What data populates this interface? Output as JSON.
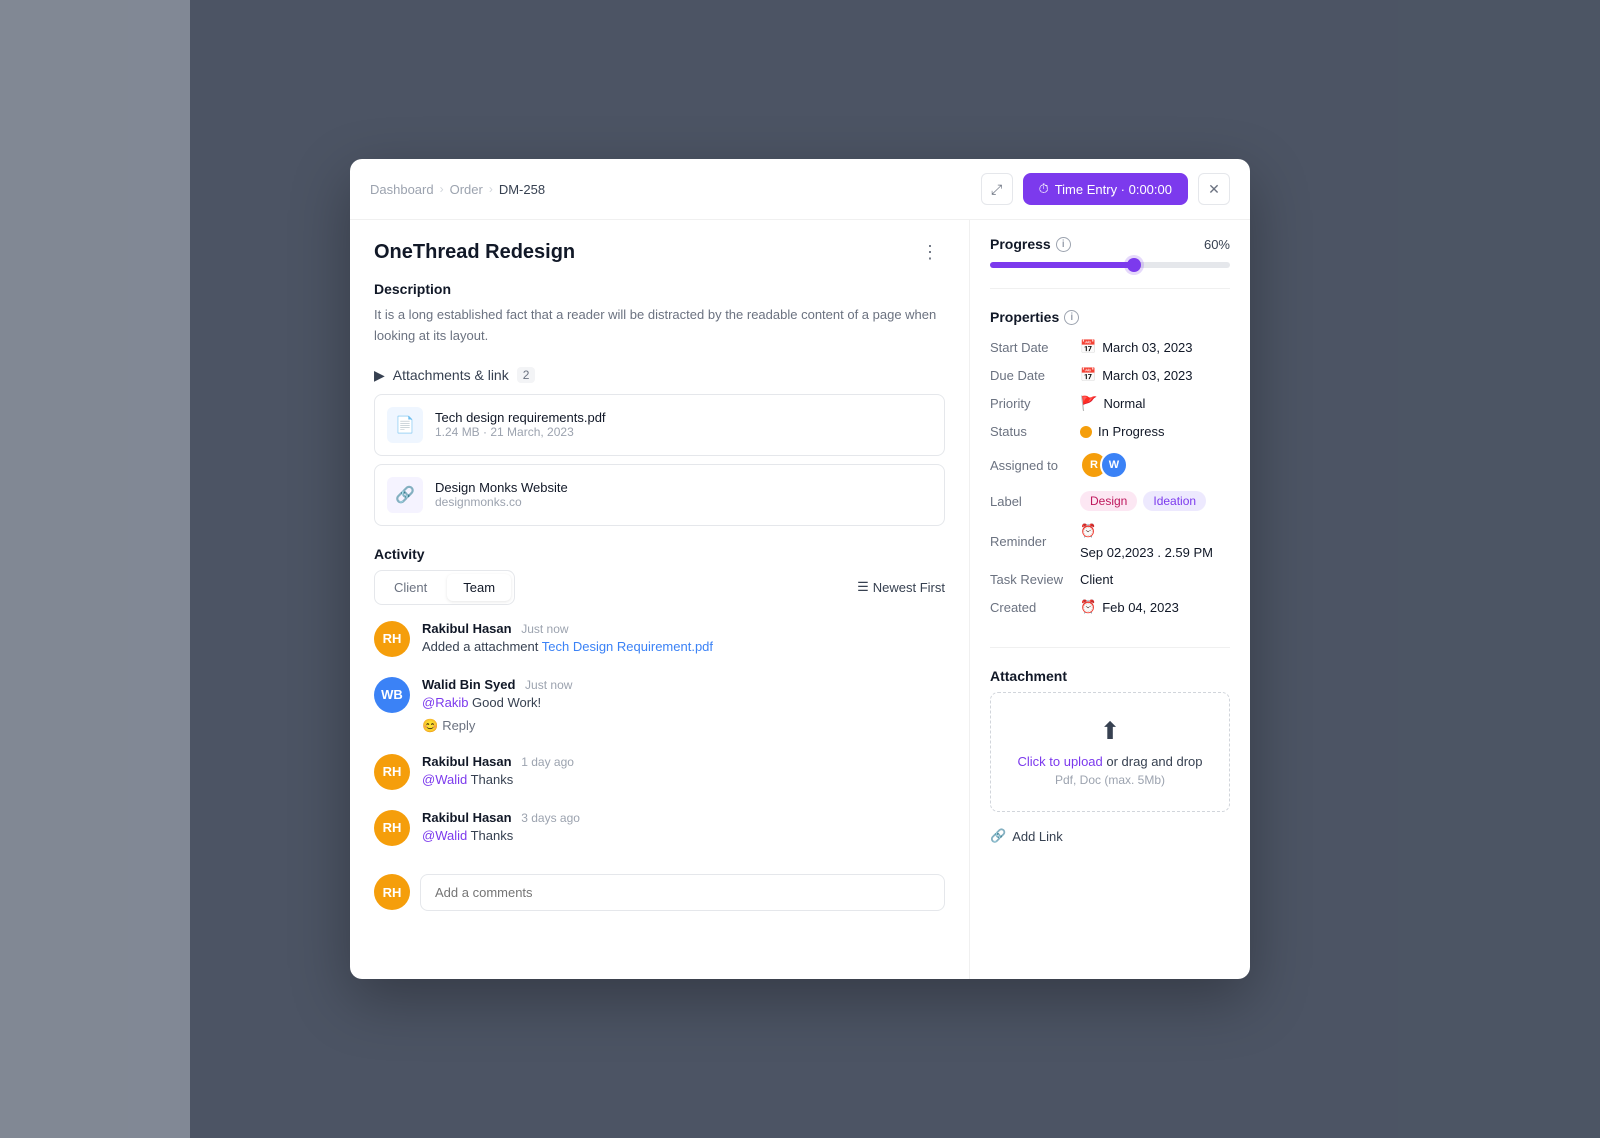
{
  "breadcrumb": {
    "items": [
      "Dashboard",
      "Order"
    ],
    "current": "DM-258"
  },
  "time_entry_btn": "Time Entry · 0:00:00",
  "task": {
    "title": "OneThread Redesign",
    "description": "It is a long established fact that a reader will be distracted by the readable content of a page when looking at its layout.",
    "attachments_label": "Attachments & link",
    "attachments_count": "2",
    "attachments": [
      {
        "name": "Tech design requirements.pdf",
        "meta": "1.24 MB · 21 March, 2023",
        "type": "file"
      },
      {
        "name": "Design Monks Website",
        "meta": "designmonks.co",
        "type": "link"
      }
    ]
  },
  "activity": {
    "label": "Activity",
    "tabs": [
      "Client",
      "Team"
    ],
    "active_tab": "Team",
    "sort": "Newest First",
    "items": [
      {
        "author": "Rakibul Hasan",
        "time": "Just now",
        "text": "Added a attachment",
        "link": "Tech Design Requirement.pdf",
        "initials": "RH",
        "type": "system"
      },
      {
        "author": "Walid Bin Syed",
        "time": "Just now",
        "mention": "@Rakib",
        "text": "Good Work!",
        "initials": "WB",
        "type": "comment"
      },
      {
        "author": "Rakibul Hasan",
        "time": "1 day ago",
        "mention": "@Walid",
        "text": "Thanks",
        "initials": "RH",
        "type": "comment"
      },
      {
        "author": "Rakibul Hasan",
        "time": "3 days ago",
        "mention": "@Walid",
        "text": "Thanks",
        "initials": "RH",
        "type": "comment"
      }
    ],
    "comment_placeholder": "Add a comments"
  },
  "progress": {
    "label": "Progress",
    "value": "60%",
    "percent": 60
  },
  "properties": {
    "label": "Properties",
    "fields": [
      {
        "key": "Start Date",
        "value": "March 03, 2023",
        "icon": "📅"
      },
      {
        "key": "Due Date",
        "value": "March 03, 2023",
        "icon": "📅"
      },
      {
        "key": "Priority",
        "value": "Normal",
        "icon": "🚩"
      },
      {
        "key": "Status",
        "value": "In Progress",
        "icon": "status"
      },
      {
        "key": "Assigned to",
        "value": "avatars",
        "icon": ""
      },
      {
        "key": "Label",
        "value": "labels",
        "icon": ""
      },
      {
        "key": "Reminder",
        "value": "Sep 02,2023 . 2.59 PM",
        "icon": "⏰"
      },
      {
        "key": "Task Review",
        "value": "Client",
        "icon": ""
      },
      {
        "key": "Created",
        "value": "Feb 04, 2023",
        "icon": "⏰"
      }
    ]
  },
  "attachment_panel": {
    "label": "Attachment",
    "upload_text_1": "Click to upload",
    "upload_text_2": " or drag and drop",
    "upload_hint": "Pdf, Doc  (max. 5Mb)",
    "add_link": "Add Link"
  }
}
